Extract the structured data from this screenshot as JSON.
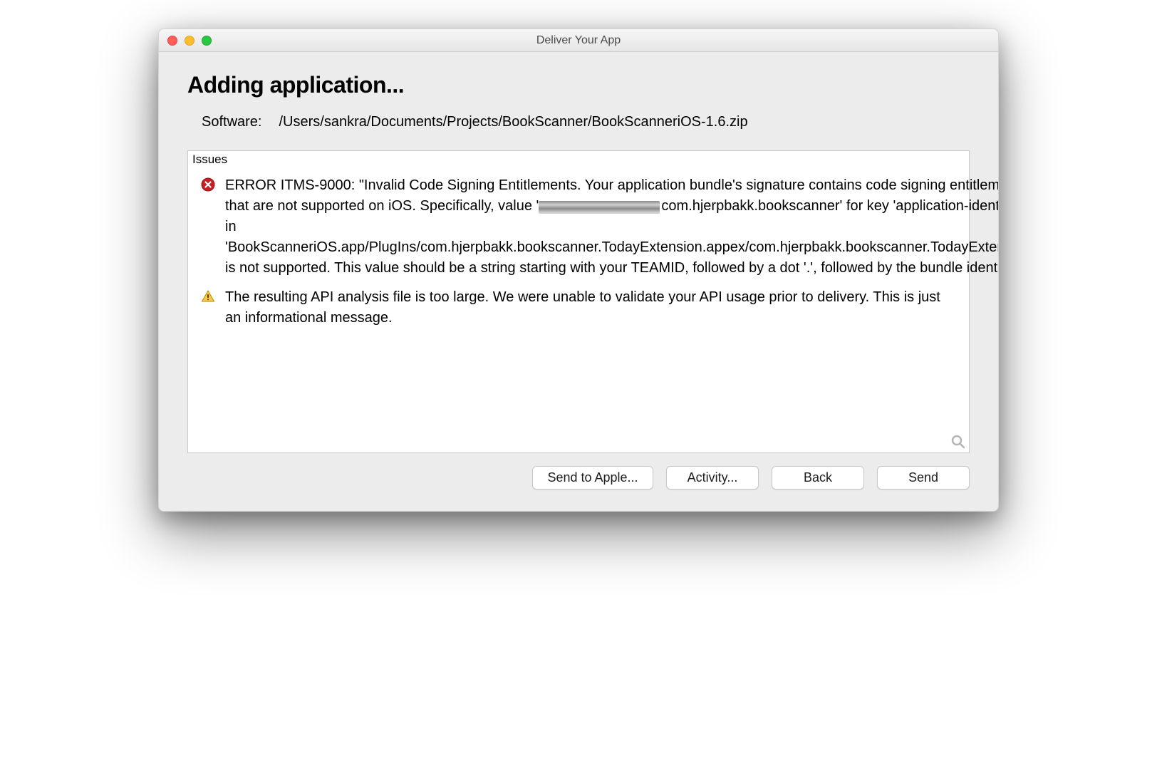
{
  "window": {
    "title": "Deliver Your App"
  },
  "heading": "Adding application...",
  "software": {
    "label": "Software:",
    "path": "/Users/sankra/Documents/Projects/BookScanner/BookScanneriOS-1.6.zip"
  },
  "issues": {
    "header": "Issues",
    "items": [
      {
        "type": "error",
        "pre": "ERROR ITMS-9000: \"Invalid Code Signing Entitlements. Your application bundle's signature contains code signing entitlements that are not supported on iOS. Specifically, value '",
        "post": "com.hjerpbakk.bookscanner' for key 'application-identifier' in 'BookScanneriOS.app/PlugIns/com.hjerpbakk.bookscanner.TodayExtension.appex/com.hjerpbakk.bookscanner.TodayExtension' is not supported. This value should be a string starting with your TEAMID, followed by a dot '.', followed by the bundle identifier.\""
      },
      {
        "type": "warning",
        "text": "The resulting API analysis file is too large.  We were unable to validate your API usage prior to delivery.  This is just an informational message."
      }
    ]
  },
  "buttons": {
    "send_to_apple": "Send to Apple...",
    "activity": "Activity...",
    "back": "Back",
    "send": "Send"
  }
}
